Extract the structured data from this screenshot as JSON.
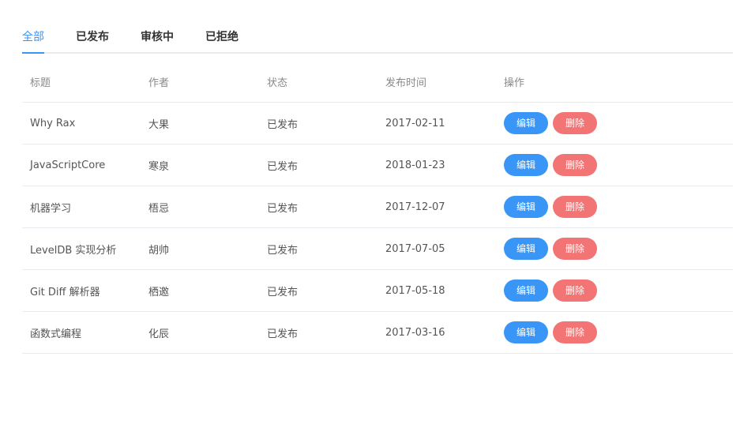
{
  "tabs": [
    {
      "label": "全部",
      "active": true
    },
    {
      "label": "已发布",
      "active": false
    },
    {
      "label": "审核中",
      "active": false
    },
    {
      "label": "已拒绝",
      "active": false
    }
  ],
  "table": {
    "headers": {
      "title": "标题",
      "author": "作者",
      "status": "状态",
      "date": "发布时间",
      "actions": "操作"
    },
    "rows": [
      {
        "title": "Why Rax",
        "author": "大果",
        "status": "已发布",
        "date": "2017-02-11"
      },
      {
        "title": "JavaScriptCore",
        "author": "寒泉",
        "status": "已发布",
        "date": "2018-01-23"
      },
      {
        "title": "机器学习",
        "author": "梧忌",
        "status": "已发布",
        "date": "2017-12-07"
      },
      {
        "title": "LevelDB 实现分析",
        "author": "胡帅",
        "status": "已发布",
        "date": "2017-07-05"
      },
      {
        "title": "Git Diff 解析器",
        "author": "栖邀",
        "status": "已发布",
        "date": "2017-05-18"
      },
      {
        "title": "函数式编程",
        "author": "化辰",
        "status": "已发布",
        "date": "2017-03-16"
      }
    ],
    "edit_label": "编辑",
    "delete_label": "删除"
  },
  "colors": {
    "accent": "#3a96f6",
    "danger": "#f27474",
    "divider": "#e8ecf1"
  }
}
